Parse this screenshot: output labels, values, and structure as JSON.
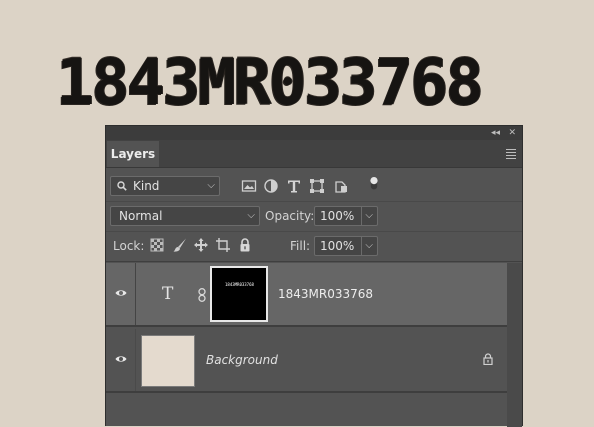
{
  "canvas": {
    "text": "1843MR033768"
  },
  "panel": {
    "tab_label": "Layers",
    "collapse_glyph": "◂◂",
    "close_glyph": "✕",
    "filter": {
      "kind_label": "Kind",
      "icons": [
        "image-filter-icon",
        "adjustment-filter-icon",
        "type-filter-icon",
        "shape-filter-icon",
        "smart-object-filter-icon",
        "filter-toggle-icon"
      ]
    },
    "blend": {
      "mode": "Normal",
      "opacity_label": "Opacity:",
      "opacity_value": "100%"
    },
    "lock": {
      "label": "Lock:",
      "fill_label": "Fill:",
      "fill_value": "100%"
    },
    "layers": [
      {
        "name": "1843MR033768",
        "kind": "text",
        "type_glyph": "T",
        "thumbnail_text": "1843MR033768",
        "selected": true,
        "visible": true
      },
      {
        "name": "Background",
        "kind": "background",
        "locked": true,
        "visible": true
      }
    ]
  },
  "colors": {
    "canvas_bg": "#dcd3c6",
    "panel_bg": "#535353",
    "selected_layer_bg": "#666666"
  }
}
